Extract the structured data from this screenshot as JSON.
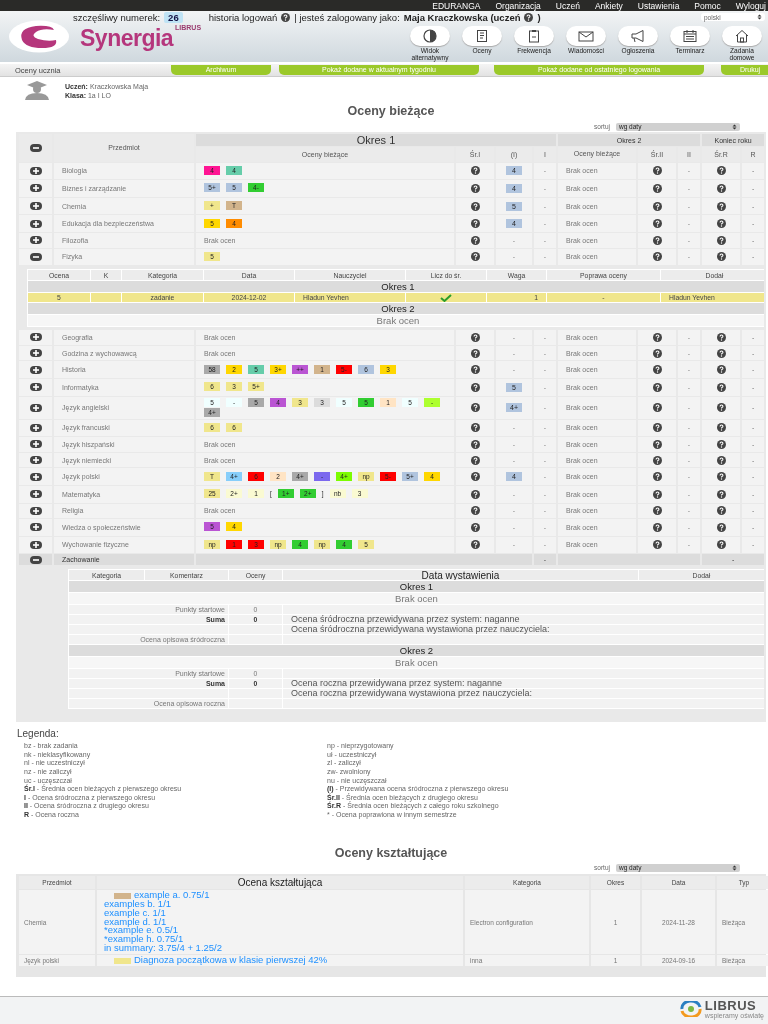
{
  "top_menu": [
    "EDURANGA",
    "Organizacja",
    "Uczeń",
    "Ankiety",
    "Ustawienia",
    "Pomoc",
    "Wyloguj"
  ],
  "header": {
    "logo_small": "LIBRUS",
    "logo": "Synergia",
    "lucky_label": "szczęśliwy numerek:",
    "lucky_number": "26",
    "history": "historia logowań",
    "logged_as": "| jesteś zalogowany jako:",
    "user": "Maja Kraczkowska (uczeń",
    "user_end": ")",
    "language": "polski"
  },
  "nav": [
    {
      "label": "Widok alternatywny",
      "kind": "contrast"
    },
    {
      "label": "Oceny",
      "kind": "grades"
    },
    {
      "label": "Frekwencja",
      "kind": "clipboard"
    },
    {
      "label": "Wiadomości",
      "kind": "mail"
    },
    {
      "label": "Ogłoszenia",
      "kind": "megaphone"
    },
    {
      "label": "Terminarz",
      "kind": "calendar"
    },
    {
      "label": "Zadania domowe",
      "kind": "house"
    }
  ],
  "tabs_bar": {
    "title": "Oceny ucznia",
    "buttons": [
      "Archiwum",
      "Pokaż dodane w aktualnym tygodniu",
      "Pokaż dodane od ostatniego logowania",
      "Drukuj"
    ]
  },
  "student": {
    "name_label": "Uczeń:",
    "name": "Kraczkowska Maja",
    "class_label": "Klasa:",
    "class": "1a I LO"
  },
  "title": "Oceny bieżące",
  "sort": {
    "label": "sortuj",
    "value": "wg daty"
  },
  "grades_table": {
    "headers": {
      "subject": "Przedmiot",
      "period_1": "Okres 1",
      "period_2": "Okres 2",
      "year_end": "Koniec roku",
      "columns": [
        "Oceny bieżące",
        "Śr.I",
        "(I)",
        "I",
        "Oceny bieżące",
        "Śr.II",
        "II",
        "Śr.R",
        "R"
      ]
    },
    "rows": [
      {
        "kind": "subject",
        "subject": "Biologia",
        "expanded": false,
        "grades": [
          {
            "v": "4",
            "color": "#ff1493"
          },
          {
            "v": "4",
            "color": "#66cdaa"
          }
        ],
        "proposed_1": {
          "v": "4",
          "color": "#b0c4de"
        },
        "final_1": "-",
        "period_2": "Brak ocen",
        "final_2": "-",
        "final_r": "-"
      },
      {
        "kind": "subject",
        "subject": "Biznes i zarządzanie",
        "expanded": false,
        "grades": [
          {
            "v": "5+",
            "color": "#b0c4de"
          },
          {
            "v": "5",
            "color": "#b0c4de"
          },
          {
            "v": "4-",
            "color": "#32cd32"
          }
        ],
        "proposed_1": {
          "v": "4",
          "color": "#b0c4de"
        },
        "final_1": "-",
        "period_2": "Brak ocen",
        "final_2": "-",
        "final_r": "-"
      },
      {
        "kind": "subject",
        "subject": "Chemia",
        "expanded": false,
        "grades": [
          {
            "v": "+",
            "color": "#f0e68c"
          },
          {
            "v": "T",
            "color": "#d2b48c"
          }
        ],
        "proposed_1": {
          "v": "5",
          "color": "#b0c4de"
        },
        "final_1": "-",
        "period_2": "Brak ocen",
        "final_2": "-",
        "final_r": "-"
      },
      {
        "kind": "subject",
        "subject": "Edukacja dla bezpieczeństwa",
        "expanded": false,
        "grades": [
          {
            "v": "5",
            "color": "#ffd700"
          },
          {
            "v": "4",
            "color": "#ff8c00"
          }
        ],
        "proposed_1": {
          "v": "4",
          "color": "#b0c4de"
        },
        "final_1": "-",
        "period_2": "Brak ocen",
        "final_2": "-",
        "final_r": "-"
      },
      {
        "kind": "subject",
        "subject": "Filozofia",
        "expanded": false,
        "grades_text": "Brak ocen",
        "proposed_1": {
          "v": "-"
        },
        "final_1": "-",
        "period_2": "Brak ocen",
        "final_2": "-",
        "final_r": "-"
      },
      {
        "kind": "subject",
        "subject": "Fizyka",
        "expanded": true,
        "grades": [
          {
            "v": "5",
            "color": "#f0e68c"
          }
        ],
        "proposed_1": {
          "v": "-"
        },
        "final_1": "-",
        "period_2": "Brak ocen",
        "final_2": "-",
        "final_r": "-",
        "details": {
          "headers": [
            "Ocena",
            "K",
            "Kategoria",
            "Data",
            "Nauczyciel",
            "Licz do śr.",
            "Waga",
            "Poprawa oceny",
            "Dodał"
          ],
          "sections": [
            {
              "title": "Okres 1",
              "rows": [
                {
                  "grade": "5",
                  "color": "#f0e68c",
                  "category": "zadanie",
                  "date": "2024-12-02",
                  "teacher": "Hladun Yevhen",
                  "counts": true,
                  "weight": "1",
                  "correction": "-",
                  "added_by": "Hladun Yevhen"
                }
              ]
            },
            {
              "title": "Okres 2",
              "empty": "Brak ocen"
            }
          ]
        }
      },
      {
        "kind": "subject",
        "subject": "Geografia",
        "expanded": false,
        "grades_text": "Brak ocen",
        "proposed_1": {
          "v": "-"
        },
        "final_1": "-",
        "period_2": "Brak ocen",
        "final_2": "-",
        "final_r": "-"
      },
      {
        "kind": "subject",
        "subject": "Godzina z wychowawcą",
        "expanded": false,
        "grades_text": "Brak ocen",
        "proposed_1": {
          "v": "-"
        },
        "final_1": "-",
        "period_2": "Brak ocen",
        "final_2": "-",
        "final_r": "-"
      },
      {
        "kind": "subject",
        "subject": "Historia",
        "expanded": false,
        "grades": [
          {
            "v": "58",
            "color": "#a9a9a9"
          },
          {
            "v": "2",
            "color": "#ffd700"
          },
          {
            "v": "5",
            "color": "#66cdaa"
          },
          {
            "v": "3+",
            "color": "#ffd700"
          },
          {
            "v": "++",
            "color": "#ba55d3"
          },
          {
            "v": "1",
            "color": "#d2b48c"
          },
          {
            "v": "5-",
            "color": "#ff0000"
          },
          {
            "v": "6",
            "color": "#b0c4de"
          },
          {
            "v": "3",
            "color": "#ffd700"
          }
        ],
        "proposed_1": {
          "v": "-"
        },
        "final_1": "-",
        "period_2": "Brak ocen",
        "final_2": "-",
        "final_r": "-"
      },
      {
        "kind": "subject",
        "subject": "Informatyka",
        "expanded": false,
        "grades": [
          {
            "v": "6",
            "color": "#f0e68c"
          },
          {
            "v": "3",
            "color": "#f0e68c"
          },
          {
            "v": "5+",
            "color": "#f0e68c"
          }
        ],
        "proposed_1": {
          "v": "5",
          "color": "#b0c4de"
        },
        "final_1": "-",
        "period_2": "Brak ocen",
        "final_2": "-",
        "final_r": "-"
      },
      {
        "kind": "subject",
        "subject": "Język angielski",
        "expanded": false,
        "grades": [
          {
            "v": "5",
            "color": "#f0ffff"
          },
          {
            "v": "-",
            "color": "#f0ffff"
          },
          {
            "v": "5",
            "color": "#a9a9a9"
          },
          {
            "v": "4",
            "color": "#ba55d3"
          },
          {
            "v": "3",
            "color": "#f0e68c"
          },
          {
            "v": "3",
            "color": "#dcdcdc"
          },
          {
            "v": "5",
            "color": "#f0ffff"
          },
          {
            "v": "5",
            "color": "#32cd32"
          },
          {
            "v": "1",
            "color": "#ffe4c4"
          },
          {
            "v": "5",
            "color": "#f0ffff"
          },
          {
            "v": "-",
            "color": "#adff2f"
          },
          {
            "v": "4+",
            "color": "#a9a9a9"
          }
        ],
        "proposed_1": {
          "v": "4+",
          "color": "#b0c4de"
        },
        "final_1": "-",
        "period_2": "Brak ocen",
        "final_2": "-",
        "final_r": "-"
      },
      {
        "kind": "subject",
        "subject": "Język francuski",
        "expanded": false,
        "grades": [
          {
            "v": "6",
            "color": "#f0e68c"
          },
          {
            "v": "6",
            "color": "#f0e68c"
          }
        ],
        "proposed_1": {
          "v": "-"
        },
        "final_1": "-",
        "period_2": "Brak ocen",
        "final_2": "-",
        "final_r": "-"
      },
      {
        "kind": "subject",
        "subject": "Język hiszpański",
        "expanded": false,
        "grades_text": "Brak ocen",
        "proposed_1": {
          "v": "-"
        },
        "final_1": "-",
        "period_2": "Brak ocen",
        "final_2": "-",
        "final_r": "-"
      },
      {
        "kind": "subject",
        "subject": "Język niemiecki",
        "expanded": false,
        "grades_text": "Brak ocen",
        "proposed_1": {
          "v": "-"
        },
        "final_1": "-",
        "period_2": "Brak ocen",
        "final_2": "-",
        "final_r": "-"
      },
      {
        "kind": "subject",
        "subject": "Język polski",
        "expanded": false,
        "grades": [
          {
            "v": "T",
            "color": "#f0e68c"
          },
          {
            "v": "4+",
            "color": "#87cefa"
          },
          {
            "v": "6",
            "color": "#ff0000"
          },
          {
            "v": "2",
            "color": "#ffe4c4"
          },
          {
            "v": "4+",
            "color": "#a9a9a9"
          },
          {
            "v": "-",
            "color": "#7b68ee"
          },
          {
            "v": "4+",
            "color": "#7cfc00"
          },
          {
            "v": "np",
            "color": "#f0e68c"
          },
          {
            "v": "5-",
            "color": "#ff0000"
          },
          {
            "v": "5+",
            "color": "#b0c4de"
          },
          {
            "v": "4",
            "color": "#ffd700"
          }
        ],
        "proposed_1": {
          "v": "4",
          "color": "#b0c4de"
        },
        "final_1": "-",
        "period_2": "Brak ocen",
        "final_2": "-",
        "final_r": "-"
      },
      {
        "kind": "subject",
        "subject": "Matematyka",
        "expanded": false,
        "grades": [
          {
            "v": "25",
            "color": "#f0e68c"
          },
          {
            "v": "2+",
            "color": "#fafad2"
          },
          {
            "v": "1",
            "color": "#fafad2"
          },
          {
            "v": "["
          },
          {
            "v": "1+",
            "color": "#32cd32"
          },
          {
            "v": "2+",
            "color": "#32cd32"
          },
          {
            "v": "]"
          },
          {
            "v": "nb",
            "color": "#fafad2"
          },
          {
            "v": "3",
            "color": "#fafad2"
          }
        ],
        "proposed_1": {
          "v": "-"
        },
        "final_1": "-",
        "period_2": "Brak ocen",
        "final_2": "-",
        "final_r": "-"
      },
      {
        "kind": "subject",
        "subject": "Religia",
        "expanded": false,
        "grades_text": "Brak ocen",
        "proposed_1": {
          "v": "-"
        },
        "final_1": "-",
        "period_2": "Brak ocen",
        "final_2": "-",
        "final_r": "-"
      },
      {
        "kind": "subject",
        "subject": "Wiedza o społeczeństwie",
        "expanded": false,
        "grades": [
          {
            "v": "5",
            "color": "#ba55d3"
          },
          {
            "v": "4",
            "color": "#ffd700"
          }
        ],
        "proposed_1": {
          "v": "-"
        },
        "final_1": "-",
        "period_2": "Brak ocen",
        "final_2": "-",
        "final_r": "-"
      },
      {
        "kind": "subject",
        "subject": "Wychowanie fizyczne",
        "expanded": false,
        "grades": [
          {
            "v": "np",
            "color": "#f0e68c"
          },
          {
            "v": "1",
            "color": "#ff0000"
          },
          {
            "v": "3",
            "color": "#ff0000"
          },
          {
            "v": "np",
            "color": "#f0e68c"
          },
          {
            "v": "4",
            "color": "#32cd32"
          },
          {
            "v": "np",
            "color": "#f0e68c"
          },
          {
            "v": "4",
            "color": "#32cd32"
          },
          {
            "v": "5",
            "color": "#f0e68c"
          }
        ],
        "proposed_1": {
          "v": "-"
        },
        "final_1": "-",
        "period_2": "Brak ocen",
        "final_2": "-",
        "final_r": "-"
      },
      {
        "kind": "behavior",
        "subject": "Zachowanie",
        "expanded": true,
        "final_1": "-",
        "final_r": "-",
        "details": {
          "headers": [
            "Kategoria",
            "Komentarz",
            "Oceny",
            "Data wystawienia",
            "Dodał"
          ],
          "sections": [
            {
              "title": "Okres 1",
              "empty": "Brak ocen",
              "lines": [
                {
                  "label": "Punkty startowe",
                  "value": "0"
                },
                {
                  "label": "Suma",
                  "bold": true,
                  "value": "0",
                  "text": "Ocena śródroczna przewidywana przez system: naganne"
                },
                {
                  "text": "Ocena śródroczna przewidywana wystawiona przez nauczyciela:"
                },
                {
                  "label": "Ocena opisowa śródroczna"
                }
              ]
            },
            {
              "title": "Okres 2",
              "empty": "Brak ocen",
              "lines": [
                {
                  "label": "Punkty startowe",
                  "value": "0"
                },
                {
                  "label": "Suma",
                  "bold": true,
                  "value": "0",
                  "text": "Ocena roczna przewidywana przez system: naganne"
                },
                {
                  "text": "Ocena roczna przewidywana wystawiona przez nauczyciela:"
                },
                {
                  "label": "Ocena opisowa roczna"
                }
              ]
            }
          ]
        }
      }
    ]
  },
  "legend": {
    "title": "Legenda:",
    "left": [
      "bz - brak zadania",
      "nk - nieklasyfikowany",
      "nl - nie uczestniczył",
      "nz - nie zaliczył",
      "uc - uczęszczał",
      "**Śr.I** - Średnia ocen bieżących z pierwszego okresu",
      "**I** - Ocena śródroczna z pierwszego okresu",
      "**II** - Ocena śródroczna z drugiego okresu",
      "**R** - Ocena roczna"
    ],
    "right": [
      "np - nieprzygotowany",
      "uł - uczestniczył",
      "zl - zaliczył",
      "zw- zwolniony",
      "nu - nie uczęszczał",
      "**(I)** - Przewidywana ocena śródroczna z pierwszego okresu",
      "**Śr.II** - Średnia ocen bieżących z drugiego okresu",
      "**Śr.R** - Średnia ocen bieżących z całego roku szkolnego",
      "* - Ocena poprawiona w innym semestrze"
    ]
  },
  "formative": {
    "title": "Oceny kształtujące",
    "sort": {
      "label": "sortuj",
      "value": "wg daty"
    },
    "headers": [
      "Przedmiot",
      "Ocena kształtująca",
      "Kategoria",
      "Okres",
      "Data",
      "Typ"
    ],
    "rows": [
      {
        "subject": "Chemia",
        "color": "#d2b48c",
        "lines": [
          "example a. 0.75/1",
          "examples b. 1/1",
          "example c. 1/1",
          "example d. 1/1",
          "*example e. 0.5/1",
          "*example h. 0.75/1",
          "in summary: 3.75/4 + 1.25/2"
        ],
        "category": "Electron configuration",
        "period": "1",
        "date": "2024-11-28",
        "type": "Bieżąca"
      },
      {
        "subject": "Język polski",
        "color": "#f0e68c",
        "lines": [
          "Diagnoza początkowa w klasie pierwszej 42%"
        ],
        "category": "inna",
        "period": "1",
        "date": "2024-09-16",
        "type": "Bieżąca"
      }
    ]
  },
  "footer": {
    "logo": "LIBRUS",
    "tagline": "wspieramy oświatę"
  }
}
